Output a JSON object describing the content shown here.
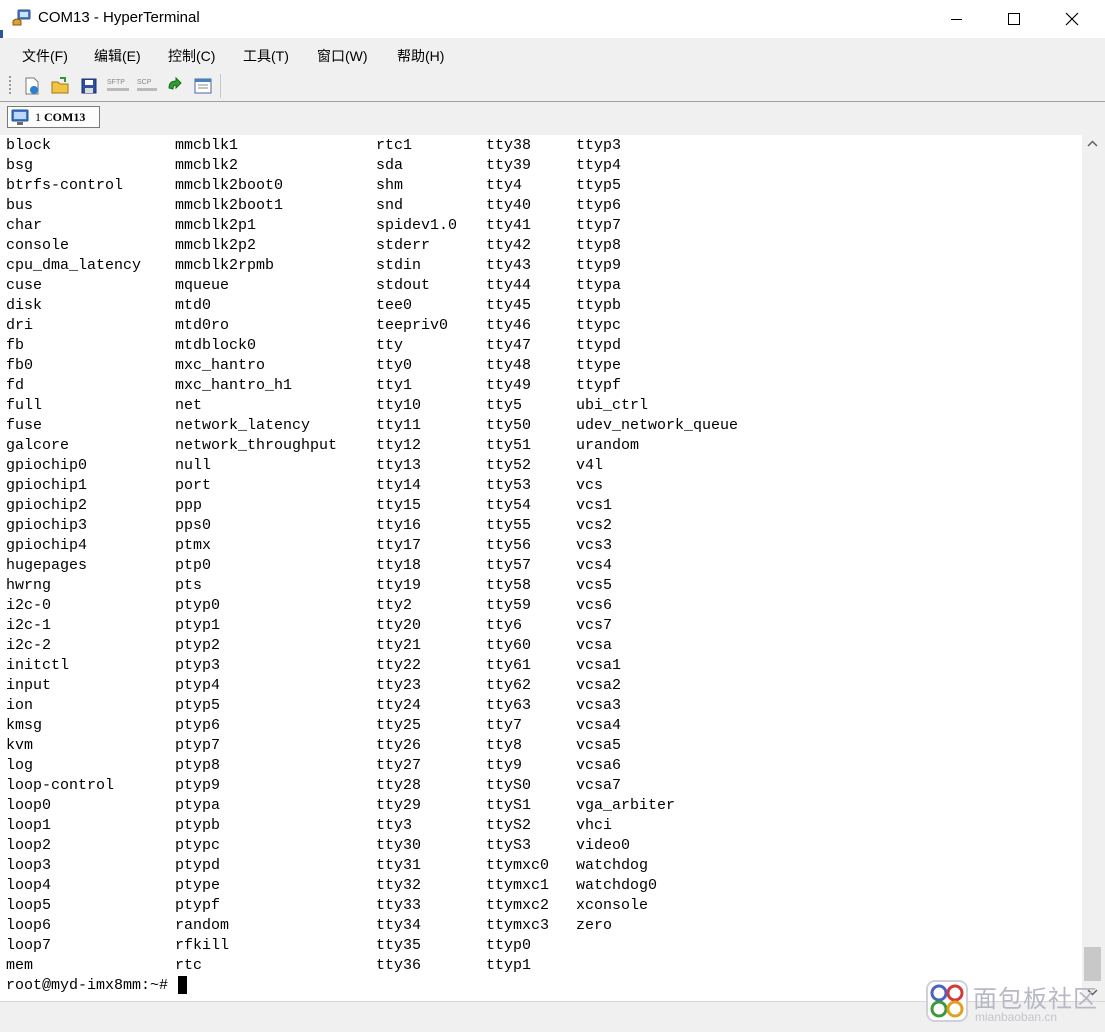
{
  "window": {
    "title": "COM13 - HyperTerminal",
    "icon": "hyperterminal-phone-icon"
  },
  "menu": {
    "file": "文件(F)",
    "edit": "编辑(E)",
    "control": "控制(C)",
    "tools": "工具(T)",
    "window": "窗口(W)",
    "help": "帮助(H)"
  },
  "toolbar": {
    "sftp_label": "SFTP",
    "scp_label": "SCP",
    "icons": [
      "new-session-icon",
      "open-folder-icon",
      "save-icon",
      "sftp-icon",
      "scp-icon",
      "reconnect-icon",
      "properties-icon"
    ]
  },
  "tab": {
    "number": "1",
    "name": "COM13"
  },
  "terminal": {
    "rows": [
      [
        "block",
        "mmcblk1",
        "rtc1",
        "tty38",
        "ttyp3"
      ],
      [
        "bsg",
        "mmcblk2",
        "sda",
        "tty39",
        "ttyp4"
      ],
      [
        "btrfs-control",
        "mmcblk2boot0",
        "shm",
        "tty4",
        "ttyp5"
      ],
      [
        "bus",
        "mmcblk2boot1",
        "snd",
        "tty40",
        "ttyp6"
      ],
      [
        "char",
        "mmcblk2p1",
        "spidev1.0",
        "tty41",
        "ttyp7"
      ],
      [
        "console",
        "mmcblk2p2",
        "stderr",
        "tty42",
        "ttyp8"
      ],
      [
        "cpu_dma_latency",
        "mmcblk2rpmb",
        "stdin",
        "tty43",
        "ttyp9"
      ],
      [
        "cuse",
        "mqueue",
        "stdout",
        "tty44",
        "ttypa"
      ],
      [
        "disk",
        "mtd0",
        "tee0",
        "tty45",
        "ttypb"
      ],
      [
        "dri",
        "mtd0ro",
        "teepriv0",
        "tty46",
        "ttypc"
      ],
      [
        "fb",
        "mtdblock0",
        "tty",
        "tty47",
        "ttypd"
      ],
      [
        "fb0",
        "mxc_hantro",
        "tty0",
        "tty48",
        "ttype"
      ],
      [
        "fd",
        "mxc_hantro_h1",
        "tty1",
        "tty49",
        "ttypf"
      ],
      [
        "full",
        "net",
        "tty10",
        "tty5",
        "ubi_ctrl"
      ],
      [
        "fuse",
        "network_latency",
        "tty11",
        "tty50",
        "udev_network_queue"
      ],
      [
        "galcore",
        "network_throughput",
        "tty12",
        "tty51",
        "urandom"
      ],
      [
        "gpiochip0",
        "null",
        "tty13",
        "tty52",
        "v4l"
      ],
      [
        "gpiochip1",
        "port",
        "tty14",
        "tty53",
        "vcs"
      ],
      [
        "gpiochip2",
        "ppp",
        "tty15",
        "tty54",
        "vcs1"
      ],
      [
        "gpiochip3",
        "pps0",
        "tty16",
        "tty55",
        "vcs2"
      ],
      [
        "gpiochip4",
        "ptmx",
        "tty17",
        "tty56",
        "vcs3"
      ],
      [
        "hugepages",
        "ptp0",
        "tty18",
        "tty57",
        "vcs4"
      ],
      [
        "hwrng",
        "pts",
        "tty19",
        "tty58",
        "vcs5"
      ],
      [
        "i2c-0",
        "ptyp0",
        "tty2",
        "tty59",
        "vcs6"
      ],
      [
        "i2c-1",
        "ptyp1",
        "tty20",
        "tty6",
        "vcs7"
      ],
      [
        "i2c-2",
        "ptyp2",
        "tty21",
        "tty60",
        "vcsa"
      ],
      [
        "initctl",
        "ptyp3",
        "tty22",
        "tty61",
        "vcsa1"
      ],
      [
        "input",
        "ptyp4",
        "tty23",
        "tty62",
        "vcsa2"
      ],
      [
        "ion",
        "ptyp5",
        "tty24",
        "tty63",
        "vcsa3"
      ],
      [
        "kmsg",
        "ptyp6",
        "tty25",
        "tty7",
        "vcsa4"
      ],
      [
        "kvm",
        "ptyp7",
        "tty26",
        "tty8",
        "vcsa5"
      ],
      [
        "log",
        "ptyp8",
        "tty27",
        "tty9",
        "vcsa6"
      ],
      [
        "loop-control",
        "ptyp9",
        "tty28",
        "ttyS0",
        "vcsa7"
      ],
      [
        "loop0",
        "ptypa",
        "tty29",
        "ttyS1",
        "vga_arbiter"
      ],
      [
        "loop1",
        "ptypb",
        "tty3",
        "ttyS2",
        "vhci"
      ],
      [
        "loop2",
        "ptypc",
        "tty30",
        "ttyS3",
        "video0"
      ],
      [
        "loop3",
        "ptypd",
        "tty31",
        "ttymxc0",
        "watchdog"
      ],
      [
        "loop4",
        "ptype",
        "tty32",
        "ttymxc1",
        "watchdog0"
      ],
      [
        "loop5",
        "ptypf",
        "tty33",
        "ttymxc2",
        "xconsole"
      ],
      [
        "loop6",
        "random",
        "tty34",
        "ttymxc3",
        "zero"
      ],
      [
        "loop7",
        "rfkill",
        "tty35",
        "ttyp0",
        ""
      ],
      [
        "mem",
        "rtc",
        "tty36",
        "ttyp1",
        ""
      ]
    ],
    "prompt": "root@myd-imx8mm:~#"
  },
  "watermark": {
    "cn": "面包板社区",
    "en": "mianbaoban.cn"
  }
}
